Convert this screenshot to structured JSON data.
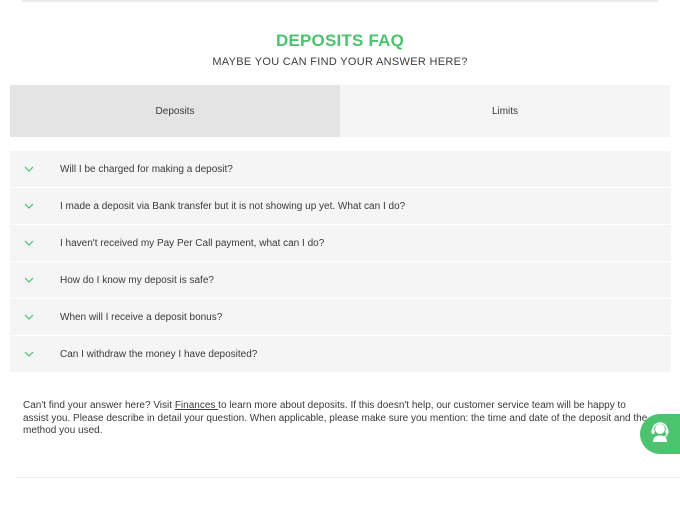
{
  "faq": {
    "title": "DEPOSITS FAQ",
    "subtitle": "MAYBE YOU CAN FIND YOUR ANSWER HERE?"
  },
  "tabs": [
    {
      "label": "Deposits",
      "active": true
    },
    {
      "label": "Limits",
      "active": false
    }
  ],
  "questions": [
    "Will I be charged for making a deposit?",
    "I made a deposit via Bank transfer but it is not showing up yet. What can I do?",
    "I haven't received my Pay Per Call payment, what can I do?",
    "How do I know my deposit is safe?",
    "When will I receive a deposit bonus?",
    "Can I withdraw the money I have deposited?"
  ],
  "help": {
    "before_link": "Can't find your answer here? Visit ",
    "link_label": "Finances ",
    "after_link": "to learn more about deposits. If this doesn't help, our customer service team will be happy to assist you. Please describe in detail your question. When applicable, please make sure you mention: the time and date of the deposit and the method you used."
  },
  "icons": {
    "chevron": "chevron-down-icon",
    "support": "headset-agent-icon"
  },
  "colors": {
    "accent": "#4cc36f",
    "active_tab": "#e4e4e4",
    "row_bg": "#f5f5f5"
  }
}
